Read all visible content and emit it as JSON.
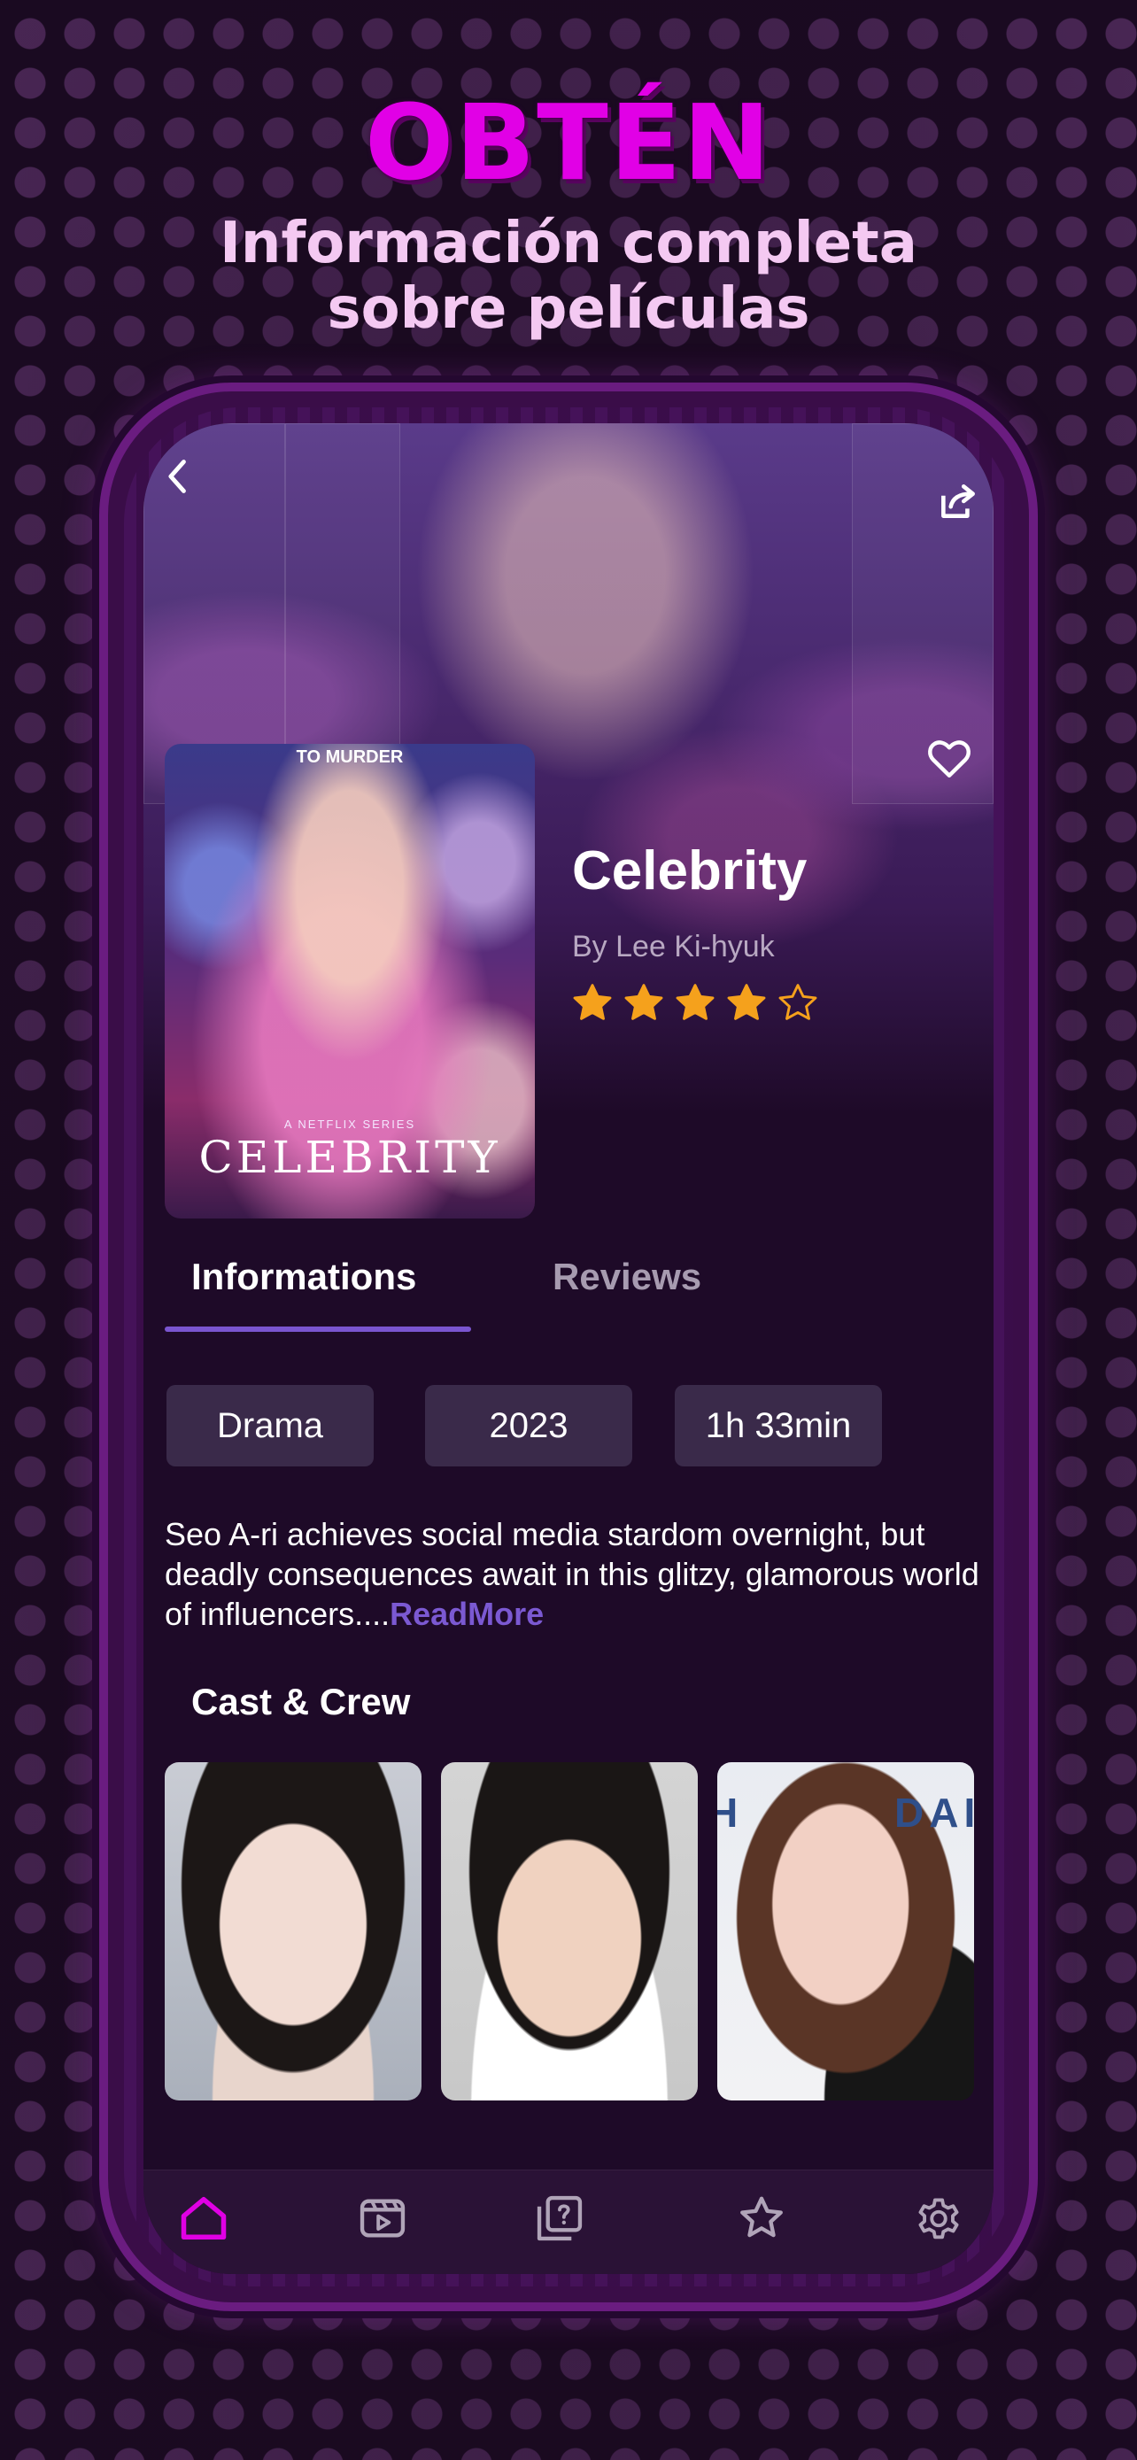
{
  "promo": {
    "headline": "OBTÉN",
    "subline_1": "Información completa",
    "subline_2": "sobre películas"
  },
  "colors": {
    "headline": "#e100e6",
    "subline": "#f4c9f2",
    "accent": "#7a55d0",
    "star": "#f5a11c",
    "nav_active": "#e000e4"
  },
  "toolbar": {
    "back_icon": "chevron-left-icon",
    "share_icon": "share-icon",
    "favorite_icon": "heart-icon"
  },
  "poster": {
    "top_text": "TO MURDER",
    "series_text": "A NETFLIX SERIES",
    "title_text": "CELEBRITY"
  },
  "movie": {
    "title": "Celebrity",
    "byline": "By  Lee Ki-hyuk",
    "rating": 4,
    "rating_max": 5
  },
  "tabs": {
    "informations": "Informations",
    "reviews": "Reviews",
    "active": "informations"
  },
  "chips": {
    "genre": "Drama",
    "year": "2023",
    "duration": "1h 33min"
  },
  "synopsis": {
    "text": "Seo A-ri achieves social media stardom overnight, but deadly consequences await in this glitzy, glamorous world of influencers....",
    "read_more": "ReadMore"
  },
  "cast": {
    "title": "Cast & Crew",
    "cast3_logo_left": "H",
    "cast3_logo_right": "DAI"
  },
  "nav": {
    "items": [
      "home-icon",
      "movies-icon",
      "quiz-icon",
      "favorites-icon",
      "settings-icon"
    ],
    "active": "home-icon"
  }
}
